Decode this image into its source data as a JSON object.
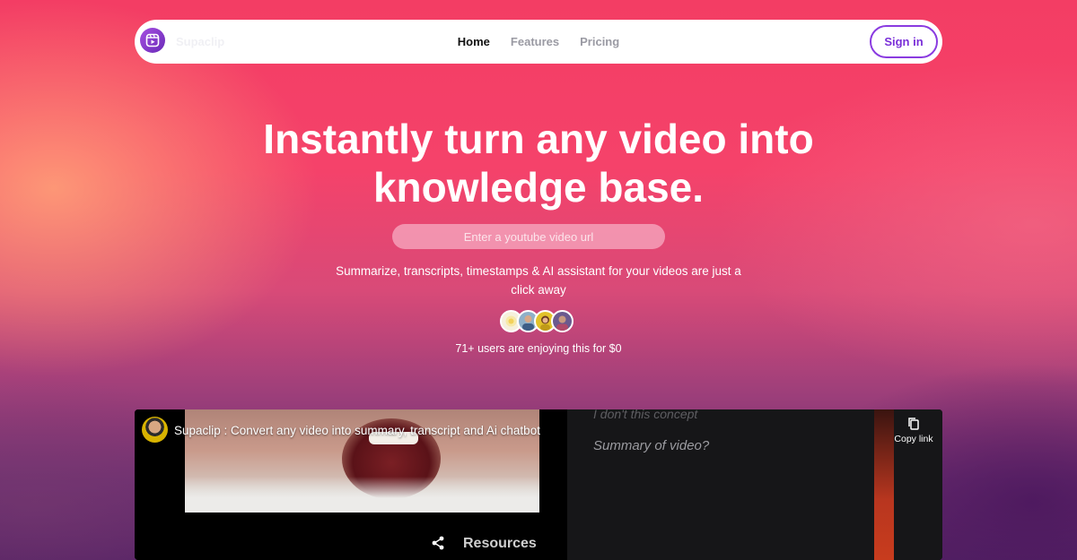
{
  "nav": {
    "brand": "Supaclip",
    "items": [
      {
        "label": "Home",
        "active": true
      },
      {
        "label": "Features",
        "active": false
      },
      {
        "label": "Pricing",
        "active": false
      }
    ],
    "signin_label": "Sign in",
    "logo_icon": "video-clip-icon"
  },
  "hero": {
    "title": "Instantly turn any video into knowledge base.",
    "url_placeholder": "Enter a youtube video url",
    "subtitle": "Summarize, transcripts, timestamps & AI assistant for your videos are just a click away",
    "users_text": "71+ users are enjoying this for $0"
  },
  "video": {
    "title": "Supaclip : Convert any video into summary, transcript and Ai chatbot",
    "resources_label": "Resources",
    "question_1": "I don't this concept",
    "question_2": "Summary of video?",
    "copy_label": "Copy link",
    "share_icon": "share-icon",
    "copy_icon": "copy-icon"
  },
  "colors": {
    "accent": "#7a2fd8",
    "nav_active": "#111111",
    "nav_inactive": "#9a9aa3"
  }
}
